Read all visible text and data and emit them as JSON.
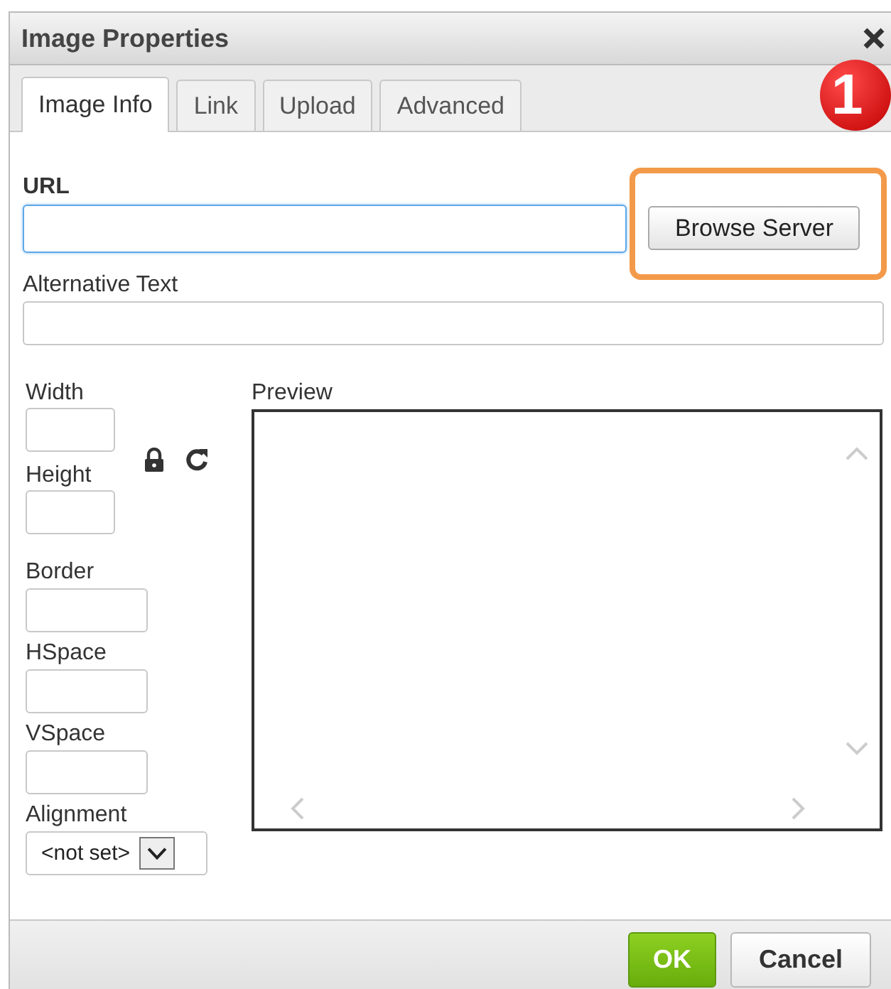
{
  "window": {
    "title": "Image Properties"
  },
  "tabs": [
    {
      "label": "Image Info",
      "selected": true
    },
    {
      "label": "Link",
      "selected": false
    },
    {
      "label": "Upload",
      "selected": false
    },
    {
      "label": "Advanced",
      "selected": false
    }
  ],
  "badge": "1",
  "url": {
    "label": "URL",
    "focused": true,
    "button": "Browse Server",
    "highlighted": true
  },
  "alt_text": {
    "label": "Alternative Text"
  },
  "size_fields": [
    {
      "label": "Width"
    },
    {
      "label": "Height"
    }
  ],
  "spacing_fields": [
    {
      "label": "Border"
    },
    {
      "label": "HSpace"
    },
    {
      "label": "VSpace"
    }
  ],
  "alignment": {
    "label": "Alignment",
    "value": "<not set>"
  },
  "preview": {
    "label": "Preview"
  },
  "buttons": [
    {
      "label": "OK",
      "kind": "primary"
    },
    {
      "label": "Cancel",
      "kind": "secondary"
    }
  ]
}
